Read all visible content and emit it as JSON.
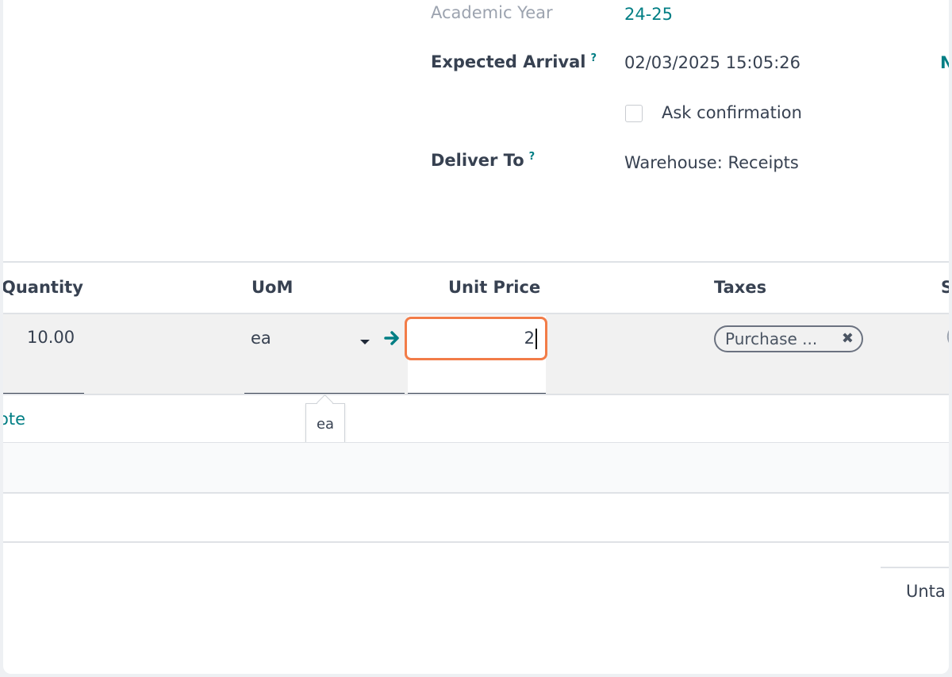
{
  "header": {
    "academic_year_label": "Academic Year",
    "academic_year_value": "24-25",
    "expected_arrival_label": "Expected Arrival",
    "expected_arrival_value": "02/03/2025 15:05:26",
    "help_marker": "?",
    "ask_confirmation_label": "Ask confirmation",
    "deliver_to_label": "Deliver To",
    "deliver_to_value": "Warehouse: Receipts",
    "right_edge_fragment": "N"
  },
  "table": {
    "columns": {
      "quantity": "Quantity",
      "uom": "UoM",
      "unit_price": "Unit Price",
      "taxes": "Taxes",
      "cut_off": "S"
    },
    "row": {
      "quantity": "10.00",
      "uom": "ea",
      "unit_price": "2",
      "tax_tag": "Purchase ...",
      "tax_remove": "✖",
      "right_fragment": "("
    },
    "add_note_fragment": "ote",
    "uom_tooltip": "ea"
  },
  "totals": {
    "untaxed_fragment": "Unta"
  },
  "colors": {
    "accent": "#017e84",
    "focus_border": "#f27c48"
  },
  "icons": {
    "dropdown": "caret-down-icon",
    "internal_link": "arrow-right-icon",
    "remove_tag": "close-icon"
  }
}
